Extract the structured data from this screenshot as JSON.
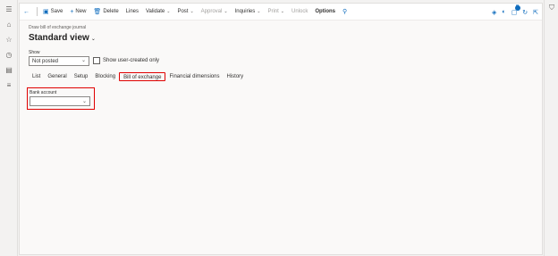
{
  "nav": {
    "icons": [
      "menu-icon",
      "home-icon",
      "star-icon",
      "clock-icon",
      "workspace-icon",
      "list-icon"
    ]
  },
  "toolbar": {
    "back_glyph": "←",
    "save_label": "Save",
    "new_label": "New",
    "delete_label": "Delete",
    "lines_label": "Lines",
    "validate_label": "Validate",
    "post_label": "Post",
    "approval_label": "Approval",
    "inquiries_label": "Inquiries",
    "print_label": "Print",
    "unlock_label": "Unlock",
    "options_label": "Options",
    "notification_count": "0"
  },
  "page": {
    "caption": "Draw bill of exchange journal",
    "title": "Standard view"
  },
  "filters": {
    "show_label": "Show",
    "show_value": "Not posted",
    "user_created_label": "Show user-created only"
  },
  "tabs": [
    {
      "label": "List"
    },
    {
      "label": "General"
    },
    {
      "label": "Setup"
    },
    {
      "label": "Blocking"
    },
    {
      "label": "Bill of exchange"
    },
    {
      "label": "Financial dimensions"
    },
    {
      "label": "History"
    }
  ],
  "bill_of_exchange": {
    "bank_account_label": "Bank account",
    "bank_account_value": ""
  }
}
